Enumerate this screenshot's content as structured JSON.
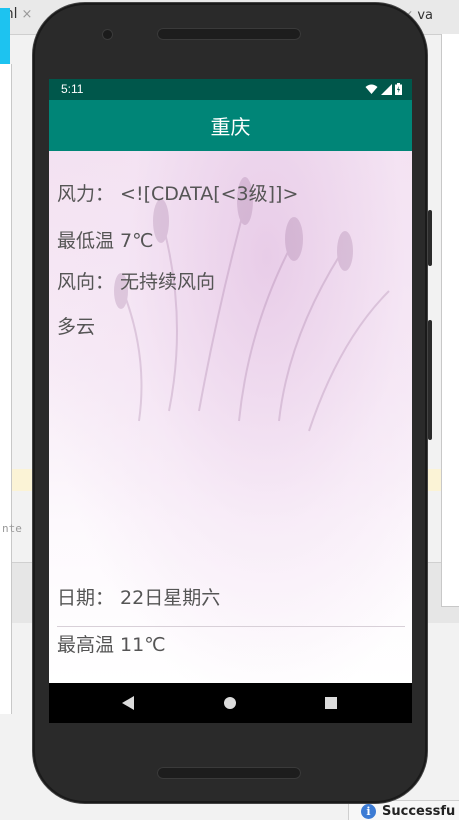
{
  "ide": {
    "left_tab_text": "ml",
    "left_tab_close": "×",
    "right_tab_close": "×",
    "right_tab_text": "va",
    "left_panel_text": "nte",
    "toast_icon": "i",
    "toast_text": "Successfu"
  },
  "status_bar": {
    "time": "5:11",
    "icons": [
      "wifi-icon",
      "signal-icon",
      "battery-icon"
    ]
  },
  "app_bar": {
    "title": "重庆"
  },
  "weather": {
    "wind_force": "风力： <![CDATA[<3级]]>",
    "low_temp": "最低温 7℃",
    "wind_direction": "风向： 无持续风向",
    "condition": "多云",
    "date": "日期： 22日星期六",
    "high_temp": "最高温 11℃"
  },
  "nav_bar": {
    "buttons": [
      "back-icon",
      "home-icon",
      "recents-icon"
    ]
  },
  "colors": {
    "status_bar": "#00574b",
    "app_bar": "#008577",
    "text": "#555555"
  }
}
